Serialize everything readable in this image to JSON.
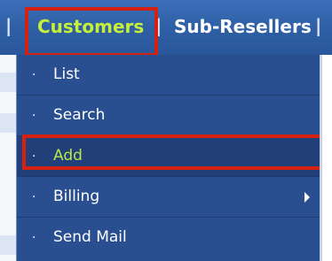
{
  "nav": {
    "items": [
      {
        "label": "Customers"
      },
      {
        "label": "Sub-Resellers"
      }
    ],
    "separator": "|"
  },
  "dropdown": {
    "items": [
      {
        "label": "List"
      },
      {
        "label": "Search"
      },
      {
        "label": "Add"
      },
      {
        "label": "Billing"
      },
      {
        "label": "Send Mail"
      }
    ],
    "bullet": "·"
  },
  "colors": {
    "bar": "#2d5da3",
    "active_text": "#c6ef39",
    "highlight_border": "#d42112"
  }
}
